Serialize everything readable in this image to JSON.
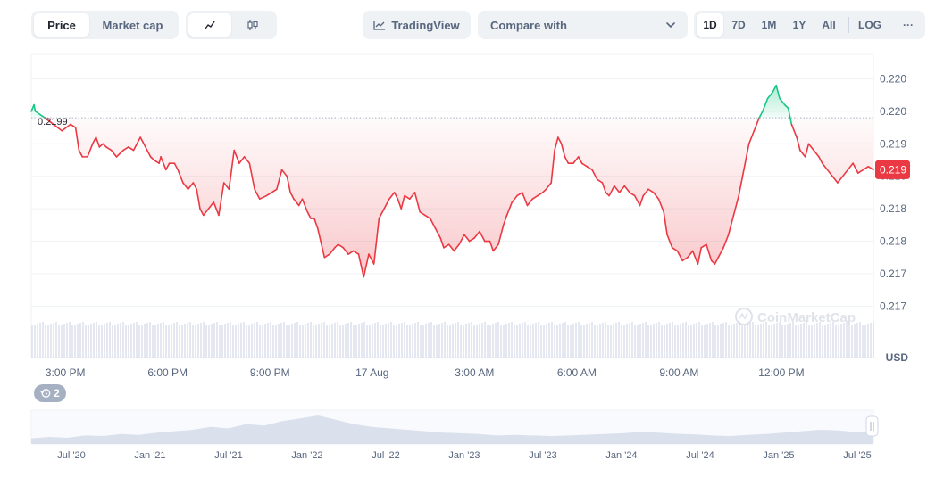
{
  "toolbar": {
    "view_tabs": [
      "Price",
      "Market cap"
    ],
    "active_view": "Price",
    "chart_style_icons": [
      "line-chart-icon",
      "candlestick-icon"
    ],
    "tradingview_label": "TradingView",
    "compare_label": "Compare with",
    "ranges": [
      "1D",
      "7D",
      "1M",
      "1Y",
      "All"
    ],
    "active_range": "1D",
    "log_label": "LOG",
    "more_label": "···"
  },
  "colors": {
    "up": "#16c784",
    "down": "#ea3943",
    "volume": "#cfd6e4",
    "grid": "#eff2f5",
    "axis_text": "#58667e"
  },
  "history_badge": {
    "count": "2"
  },
  "watermark": "CoinMarketCap",
  "chart_data": [
    {
      "type": "line",
      "currency_label": "USD",
      "reference_price": 0.2199,
      "reference_label": "0.2199",
      "current_price_label": "0.219",
      "y_tick_labels": [
        "0.220",
        "0.220",
        "0.219",
        "0.219",
        "0.218",
        "0.218",
        "0.217",
        "0.217"
      ],
      "y_tick_values": [
        0.2205,
        0.22,
        0.2195,
        0.219,
        0.2185,
        0.218,
        0.2175,
        0.217
      ],
      "ylim": [
        0.21695,
        0.22085
      ],
      "x_tick_labels": [
        "3:00 PM",
        "6:00 PM",
        "9:00 PM",
        "17 Aug",
        "3:00 AM",
        "6:00 AM",
        "9:00 AM",
        "12:00 PM"
      ],
      "x_tick_hours": [
        1.0,
        4.0,
        7.0,
        10.0,
        13.0,
        16.0,
        19.0,
        22.0
      ],
      "x_range_hours": [
        0,
        24.7
      ],
      "prices": [
        [
          0.0,
          0.22
        ],
        [
          0.08,
          0.2201
        ],
        [
          0.12,
          0.22
        ],
        [
          0.4,
          0.2199
        ],
        [
          0.9,
          0.2197
        ],
        [
          1.15,
          0.2198
        ],
        [
          1.3,
          0.21975
        ],
        [
          1.4,
          0.2194
        ],
        [
          1.5,
          0.2193
        ],
        [
          1.65,
          0.2193
        ],
        [
          1.8,
          0.2195
        ],
        [
          1.9,
          0.2196
        ],
        [
          2.0,
          0.21945
        ],
        [
          2.1,
          0.2195
        ],
        [
          2.2,
          0.21945
        ],
        [
          2.35,
          0.2194
        ],
        [
          2.5,
          0.2193
        ],
        [
          2.7,
          0.2194
        ],
        [
          2.85,
          0.21945
        ],
        [
          3.0,
          0.2194
        ],
        [
          3.2,
          0.2196
        ],
        [
          3.3,
          0.2195
        ],
        [
          3.4,
          0.2194
        ],
        [
          3.5,
          0.2193
        ],
        [
          3.6,
          0.21925
        ],
        [
          3.75,
          0.2192
        ],
        [
          3.8,
          0.2193
        ],
        [
          3.95,
          0.2191
        ],
        [
          4.05,
          0.2192
        ],
        [
          4.2,
          0.2192
        ],
        [
          4.3,
          0.2191
        ],
        [
          4.45,
          0.2189
        ],
        [
          4.6,
          0.2188
        ],
        [
          4.75,
          0.2189
        ],
        [
          4.85,
          0.2188
        ],
        [
          4.95,
          0.2185
        ],
        [
          5.05,
          0.2184
        ],
        [
          5.2,
          0.2185
        ],
        [
          5.35,
          0.2186
        ],
        [
          5.5,
          0.2184
        ],
        [
          5.65,
          0.2189
        ],
        [
          5.8,
          0.2188
        ],
        [
          5.95,
          0.2194
        ],
        [
          6.1,
          0.2192
        ],
        [
          6.25,
          0.2193
        ],
        [
          6.4,
          0.2192
        ],
        [
          6.55,
          0.2188
        ],
        [
          6.7,
          0.21865
        ],
        [
          6.9,
          0.2187
        ],
        [
          7.05,
          0.21875
        ],
        [
          7.2,
          0.2188
        ],
        [
          7.35,
          0.2191
        ],
        [
          7.5,
          0.219
        ],
        [
          7.6,
          0.21875
        ],
        [
          7.7,
          0.21865
        ],
        [
          7.85,
          0.21855
        ],
        [
          7.95,
          0.21865
        ],
        [
          8.1,
          0.21845
        ],
        [
          8.2,
          0.21835
        ],
        [
          8.3,
          0.21835
        ],
        [
          8.4,
          0.2182
        ],
        [
          8.6,
          0.21775
        ],
        [
          8.75,
          0.2178
        ],
        [
          8.9,
          0.2179
        ],
        [
          9.0,
          0.21795
        ],
        [
          9.15,
          0.2179
        ],
        [
          9.3,
          0.2178
        ],
        [
          9.45,
          0.21785
        ],
        [
          9.6,
          0.2178
        ],
        [
          9.75,
          0.21745
        ],
        [
          9.9,
          0.2178
        ],
        [
          10.05,
          0.21765
        ],
        [
          10.2,
          0.21835
        ],
        [
          10.35,
          0.2185
        ],
        [
          10.5,
          0.21865
        ],
        [
          10.65,
          0.21875
        ],
        [
          10.75,
          0.21865
        ],
        [
          10.85,
          0.2185
        ],
        [
          10.95,
          0.2187
        ],
        [
          11.1,
          0.21865
        ],
        [
          11.25,
          0.21875
        ],
        [
          11.4,
          0.21845
        ],
        [
          11.55,
          0.2184
        ],
        [
          11.7,
          0.21835
        ],
        [
          11.85,
          0.2182
        ],
        [
          12.0,
          0.21805
        ],
        [
          12.1,
          0.2179
        ],
        [
          12.25,
          0.21795
        ],
        [
          12.4,
          0.21785
        ],
        [
          12.55,
          0.21795
        ],
        [
          12.7,
          0.2181
        ],
        [
          12.85,
          0.218
        ],
        [
          13.0,
          0.21805
        ],
        [
          13.15,
          0.21815
        ],
        [
          13.3,
          0.218
        ],
        [
          13.45,
          0.218
        ],
        [
          13.55,
          0.21785
        ],
        [
          13.7,
          0.21795
        ],
        [
          13.85,
          0.21825
        ],
        [
          13.95,
          0.2184
        ],
        [
          14.1,
          0.2186
        ],
        [
          14.25,
          0.2187
        ],
        [
          14.4,
          0.21875
        ],
        [
          14.55,
          0.21855
        ],
        [
          14.7,
          0.21865
        ],
        [
          14.85,
          0.2187
        ],
        [
          15.0,
          0.21875
        ],
        [
          15.1,
          0.2188
        ],
        [
          15.25,
          0.2189
        ],
        [
          15.35,
          0.2194
        ],
        [
          15.45,
          0.2196
        ],
        [
          15.55,
          0.2195
        ],
        [
          15.65,
          0.2193
        ],
        [
          15.75,
          0.2192
        ],
        [
          15.9,
          0.2192
        ],
        [
          16.05,
          0.2193
        ],
        [
          16.15,
          0.2192
        ],
        [
          16.3,
          0.21915
        ],
        [
          16.45,
          0.2191
        ],
        [
          16.6,
          0.21895
        ],
        [
          16.75,
          0.2189
        ],
        [
          16.85,
          0.21875
        ],
        [
          16.95,
          0.2187
        ],
        [
          17.1,
          0.21885
        ],
        [
          17.25,
          0.21875
        ],
        [
          17.4,
          0.21885
        ],
        [
          17.55,
          0.21875
        ],
        [
          17.7,
          0.2187
        ],
        [
          17.85,
          0.21855
        ],
        [
          17.95,
          0.2187
        ],
        [
          18.1,
          0.2188
        ],
        [
          18.25,
          0.21875
        ],
        [
          18.4,
          0.21865
        ],
        [
          18.55,
          0.21845
        ],
        [
          18.65,
          0.2181
        ],
        [
          18.8,
          0.2179
        ],
        [
          18.95,
          0.21785
        ],
        [
          19.1,
          0.2177
        ],
        [
          19.25,
          0.21775
        ],
        [
          19.4,
          0.21785
        ],
        [
          19.55,
          0.21765
        ],
        [
          19.65,
          0.2179
        ],
        [
          19.8,
          0.21795
        ],
        [
          19.95,
          0.2177
        ],
        [
          20.05,
          0.21765
        ],
        [
          20.15,
          0.21775
        ],
        [
          20.3,
          0.2179
        ],
        [
          20.45,
          0.2181
        ],
        [
          20.6,
          0.2184
        ],
        [
          20.75,
          0.2187
        ],
        [
          20.9,
          0.2191
        ],
        [
          21.05,
          0.2195
        ],
        [
          21.2,
          0.2197
        ],
        [
          21.35,
          0.2199
        ],
        [
          21.45,
          0.22
        ],
        [
          21.6,
          0.2202
        ],
        [
          21.75,
          0.2203
        ],
        [
          21.85,
          0.2204
        ],
        [
          21.95,
          0.2202
        ],
        [
          22.1,
          0.2201
        ],
        [
          22.2,
          0.22005
        ],
        [
          22.3,
          0.2198
        ],
        [
          22.45,
          0.2196
        ],
        [
          22.55,
          0.2194
        ],
        [
          22.7,
          0.2193
        ],
        [
          22.8,
          0.2195
        ],
        [
          22.95,
          0.2194
        ],
        [
          23.1,
          0.2193
        ],
        [
          23.2,
          0.2192
        ],
        [
          23.35,
          0.2191
        ],
        [
          23.5,
          0.219
        ],
        [
          23.65,
          0.2189
        ],
        [
          23.8,
          0.219
        ],
        [
          23.95,
          0.2191
        ],
        [
          24.1,
          0.2192
        ],
        [
          24.25,
          0.21905
        ],
        [
          24.4,
          0.2191
        ],
        [
          24.55,
          0.21915
        ],
        [
          24.7,
          0.2191
        ]
      ]
    },
    {
      "type": "area",
      "role": "history-navigator",
      "x_tick_labels": [
        "Jul '20",
        "Jan '21",
        "Jul '21",
        "Jan '22",
        "Jul '22",
        "Jan '23",
        "Jul '23",
        "Jan '24",
        "Jul '24",
        "Jan '25",
        "Jul '25"
      ],
      "values": [
        0.2,
        0.25,
        0.22,
        0.3,
        0.28,
        0.35,
        0.32,
        0.4,
        0.45,
        0.5,
        0.6,
        0.55,
        0.7,
        0.65,
        0.8,
        0.9,
        1.0,
        0.85,
        0.7,
        0.6,
        0.55,
        0.5,
        0.45,
        0.4,
        0.38,
        0.35,
        0.3,
        0.32,
        0.3,
        0.28,
        0.3,
        0.33,
        0.35,
        0.38,
        0.42,
        0.4,
        0.36,
        0.34,
        0.3,
        0.28,
        0.32,
        0.35,
        0.4,
        0.45,
        0.5,
        0.48,
        0.42,
        0.4
      ]
    }
  ]
}
